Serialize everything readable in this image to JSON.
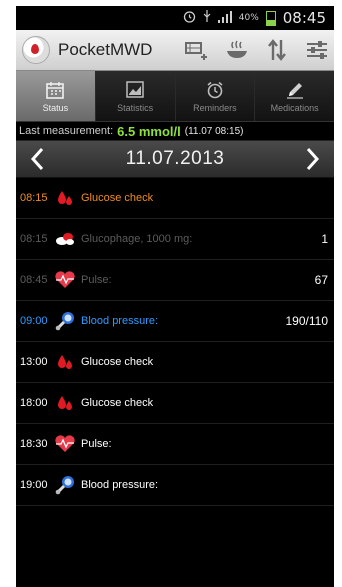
{
  "status_bar": {
    "battery_percent": "40%",
    "time": "08:45",
    "icons": [
      "alarm-icon",
      "usb-icon",
      "signal-icon",
      "battery-icon"
    ]
  },
  "action_bar": {
    "title": "PocketMWD",
    "actions": [
      "add-entry-icon",
      "meal-icon",
      "sort-icon",
      "filter-sliders-icon"
    ]
  },
  "tabs": [
    {
      "label": "Status",
      "icon": "calendar-icon",
      "active": true
    },
    {
      "label": "Statistics",
      "icon": "chart-icon",
      "active": false
    },
    {
      "label": "Reminders",
      "icon": "alarm-clock-icon",
      "active": false
    },
    {
      "label": "Medications",
      "icon": "pencil-icon",
      "active": false
    }
  ],
  "last_measurement": {
    "label": "Last measurement:",
    "value": "6.5 mmol/l",
    "timestamp": "(11.07 08:15)"
  },
  "date_nav": {
    "date": "11.07.2013"
  },
  "entries": [
    {
      "time": "08:15",
      "icon": "blood-drop-icon",
      "label": "Glucose check",
      "value": "",
      "style": "orange"
    },
    {
      "time": "08:15",
      "icon": "pills-icon",
      "label": "Glucophage, 1000 mg:",
      "value": "1",
      "style": "dim"
    },
    {
      "time": "08:45",
      "icon": "heart-pulse-icon",
      "label": "Pulse:",
      "value": "67",
      "style": "dim"
    },
    {
      "time": "09:00",
      "icon": "blood-pressure-icon",
      "label": "Blood pressure:",
      "value": "190/110",
      "style": "blue"
    },
    {
      "time": "13:00",
      "icon": "blood-drop-icon",
      "label": "Glucose check",
      "value": "",
      "style": "normal"
    },
    {
      "time": "18:00",
      "icon": "blood-drop-icon",
      "label": "Glucose check",
      "value": "",
      "style": "normal"
    },
    {
      "time": "18:30",
      "icon": "heart-pulse-icon",
      "label": "Pulse:",
      "value": "",
      "style": "normal"
    },
    {
      "time": "19:00",
      "icon": "blood-pressure-icon",
      "label": "Blood pressure:",
      "value": "",
      "style": "normal"
    }
  ],
  "colors": {
    "accent_orange": "#f08c22",
    "accent_blue": "#2e9bff",
    "measurement_green": "#8ee03e",
    "dimmed_text": "#5c5c5c"
  }
}
